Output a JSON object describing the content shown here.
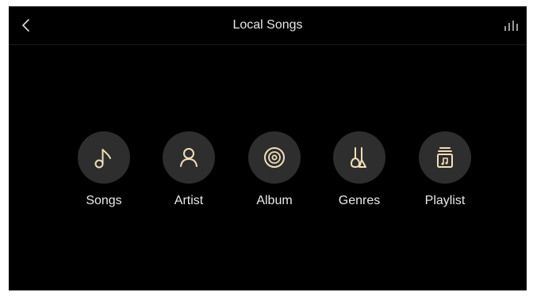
{
  "header": {
    "title": "Local Songs",
    "back_icon": "chevron-left-icon",
    "eq_icon": "equalizer-icon"
  },
  "categories": [
    {
      "label": "Songs",
      "icon": "music-note-icon"
    },
    {
      "label": "Artist",
      "icon": "person-icon"
    },
    {
      "label": "Album",
      "icon": "disc-icon"
    },
    {
      "label": "Genres",
      "icon": "guitar-icon"
    },
    {
      "label": "Playlist",
      "icon": "playlist-icon"
    }
  ],
  "colors": {
    "background": "#000000",
    "icon_accent": "#f1ddb9",
    "circle": "#2e2e2e",
    "text": "#e9e9e9"
  }
}
